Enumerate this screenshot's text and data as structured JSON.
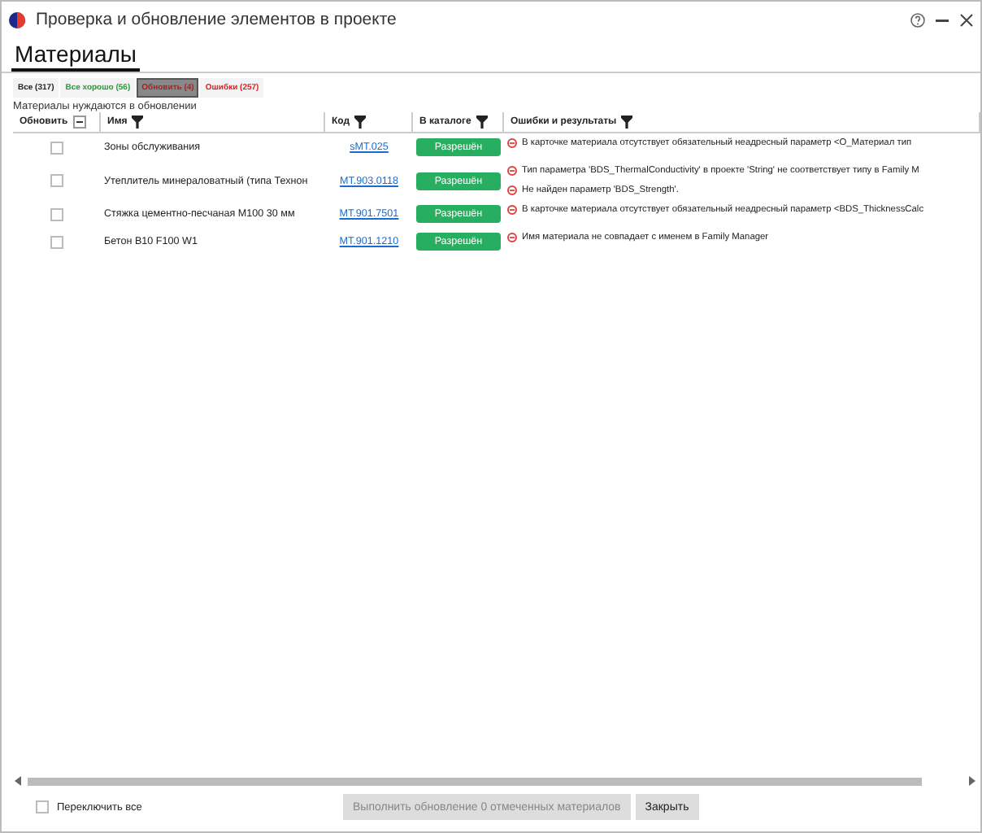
{
  "window": {
    "title": "Проверка и обновление элементов в проекте"
  },
  "page_tab": {
    "label": "Материалы"
  },
  "filters": [
    {
      "label": "Все (317)",
      "kind": "all",
      "selected": false
    },
    {
      "label": "Все хорошо (56)",
      "kind": "ok",
      "selected": false
    },
    {
      "label": "Обновить (4)",
      "kind": "update",
      "selected": true
    },
    {
      "label": "Ошибки (257)",
      "kind": "error",
      "selected": false
    }
  ],
  "subtitle": "Материалы нуждаются в обновлении",
  "table": {
    "columns": [
      "Обновить",
      "Имя",
      "Код",
      "В каталоге",
      "Ошибки и результаты"
    ],
    "rows": [
      {
        "checked": false,
        "name": "Зоны обслуживания",
        "code": "sMT.025",
        "catalog": "Разрешён",
        "errors": [
          "В карточке материала отсутствует обязательный неадресный параметр <О_Материал тип"
        ]
      },
      {
        "checked": false,
        "name": "Утеплитель минераловатный (типа Технон",
        "code": "MT.903.0118",
        "catalog": "Разрешён",
        "errors": [
          "Тип параметра 'BDS_ThermalConductivity' в проекте 'String' не соответствует типу в Family M",
          "Не найден параметр 'BDS_Strength'."
        ]
      },
      {
        "checked": false,
        "name": "Стяжка цементно-песчаная М100 30 мм",
        "code": "MT.901.7501",
        "catalog": "Разрешён",
        "errors": [
          "В карточке материала отсутствует обязательный неадресный параметр <BDS_ThicknessCalc"
        ]
      },
      {
        "checked": false,
        "name": "Бетон В10 F100 W1",
        "code": "MT.901.1210",
        "catalog": "Разрешён",
        "errors": [
          "Имя материала не совпадает с именем в Family Manager"
        ]
      }
    ]
  },
  "footer": {
    "toggle_all": {
      "label": "Переключить все",
      "checked": false
    },
    "run_button": {
      "label": "Выполнить обновление 0 отмеченных материалов",
      "disabled": true
    },
    "close_button": "Закрыть"
  }
}
